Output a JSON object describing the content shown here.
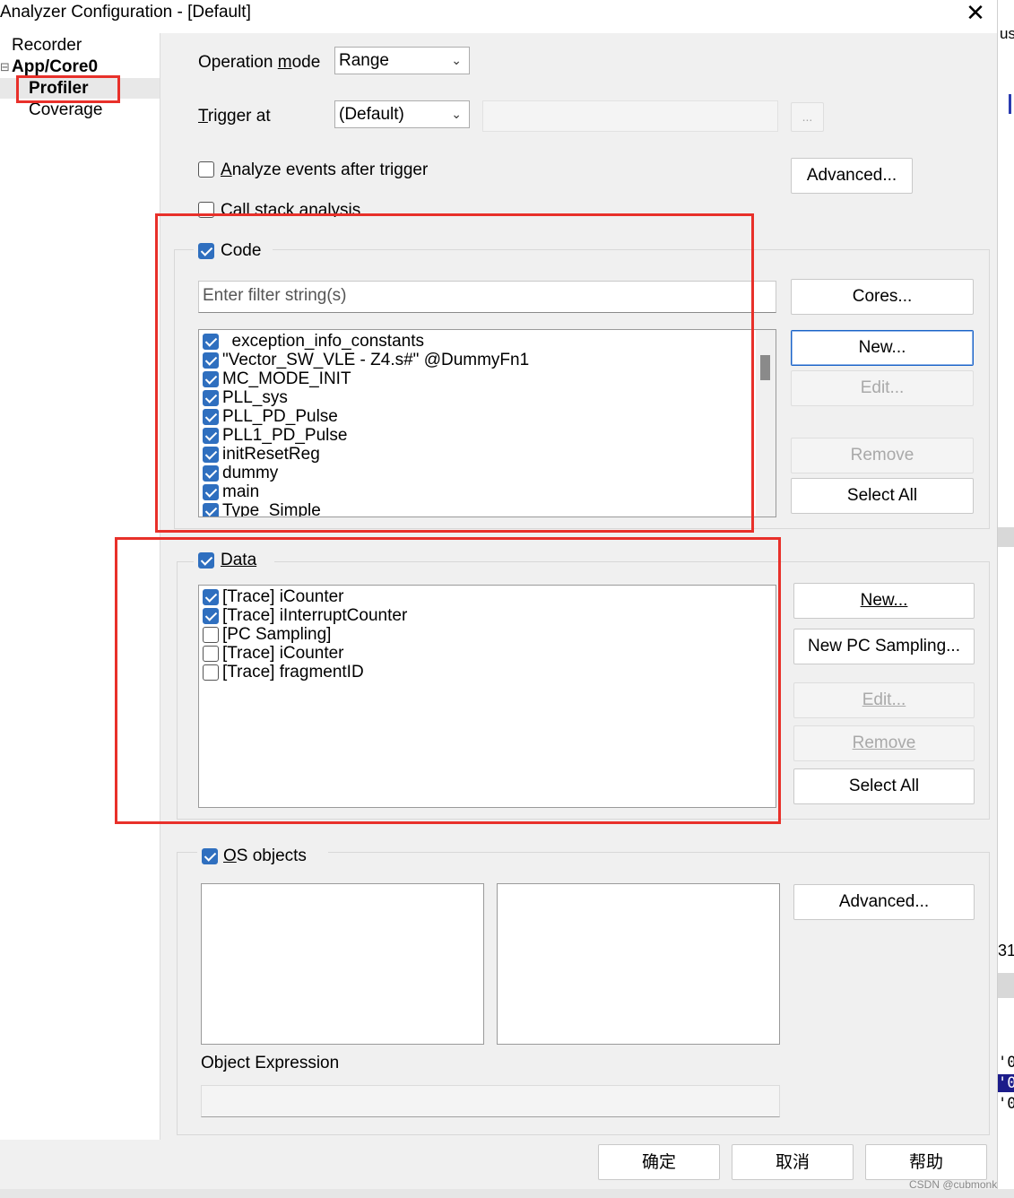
{
  "window": {
    "title": "Analyzer Configuration - [Default]",
    "close_glyph": "✕"
  },
  "tree": {
    "items": [
      {
        "label": "Recorder"
      },
      {
        "label": "App/Core0",
        "expander": "⊟"
      },
      {
        "label": "Profiler",
        "selected": true
      },
      {
        "label": "Coverage"
      }
    ]
  },
  "top": {
    "operation_mode_label_pre": "Operation ",
    "operation_mode_label_u": "m",
    "operation_mode_label_post": "ode",
    "operation_mode_value": "Range",
    "trigger_label_u": "T",
    "trigger_label_post": "rigger at",
    "trigger_value": "(Default)",
    "ellipsis_button": "...",
    "analyze_events_u": "A",
    "analyze_events_post": "nalyze events after trigger",
    "analyze_events_checked": false,
    "advanced_button": "Advanced...",
    "call_stack_label": "Call stack analysis",
    "call_stack_checked": false
  },
  "code": {
    "label": "Code",
    "checked": true,
    "filter_placeholder": "Enter filter string(s)",
    "items": [
      {
        "label": "  exception_info_constants",
        "checked": true
      },
      {
        "label": "\"Vector_SW_VLE - Z4.s#\" @DummyFn1",
        "checked": true
      },
      {
        "label": "MC_MODE_INIT",
        "checked": true
      },
      {
        "label": "PLL_sys",
        "checked": true
      },
      {
        "label": "PLL_PD_Pulse",
        "checked": true
      },
      {
        "label": "PLL1_PD_Pulse",
        "checked": true
      },
      {
        "label": "initResetReg",
        "checked": true
      },
      {
        "label": "dummy",
        "checked": true
      },
      {
        "label": "main",
        "checked": true
      },
      {
        "label": "Type_Simple",
        "checked": true
      }
    ],
    "buttons": {
      "cores": "Cores...",
      "new": "New...",
      "edit": "Edit...",
      "remove": "Remove",
      "select_all": "Select All"
    }
  },
  "data_group": {
    "label": "Data",
    "checked": true,
    "items": [
      {
        "label": "[Trace] iCounter",
        "checked": true
      },
      {
        "label": "[Trace] iInterruptCounter",
        "checked": true
      },
      {
        "label": "[PC Sampling]",
        "checked": false
      },
      {
        "label": "[Trace] iCounter",
        "checked": false
      },
      {
        "label": "[Trace] fragmentID",
        "checked": false
      }
    ],
    "buttons": {
      "new": "New...",
      "new_pc_sampling": "New PC Sampling...",
      "edit": "Edit...",
      "remove": "Remove",
      "select_all": "Select All"
    }
  },
  "os_objects": {
    "label_u": "O",
    "label_post": "S objects",
    "checked": true,
    "advanced_button": "Advanced...",
    "object_expression_label": "Object Expression",
    "object_expression_value": ""
  },
  "footer": {
    "ok": "确定",
    "cancel": "取消",
    "help": "帮助"
  },
  "watermark": "CSDN @cubmonk",
  "background_fragments": {
    "top": "us",
    "mid": "31",
    "rows": [
      "'0",
      "'0",
      "'0"
    ]
  },
  "colors": {
    "highlight_red": "#e8302a",
    "check_blue": "#2f6fbf",
    "focus_blue": "#1a63c7"
  }
}
